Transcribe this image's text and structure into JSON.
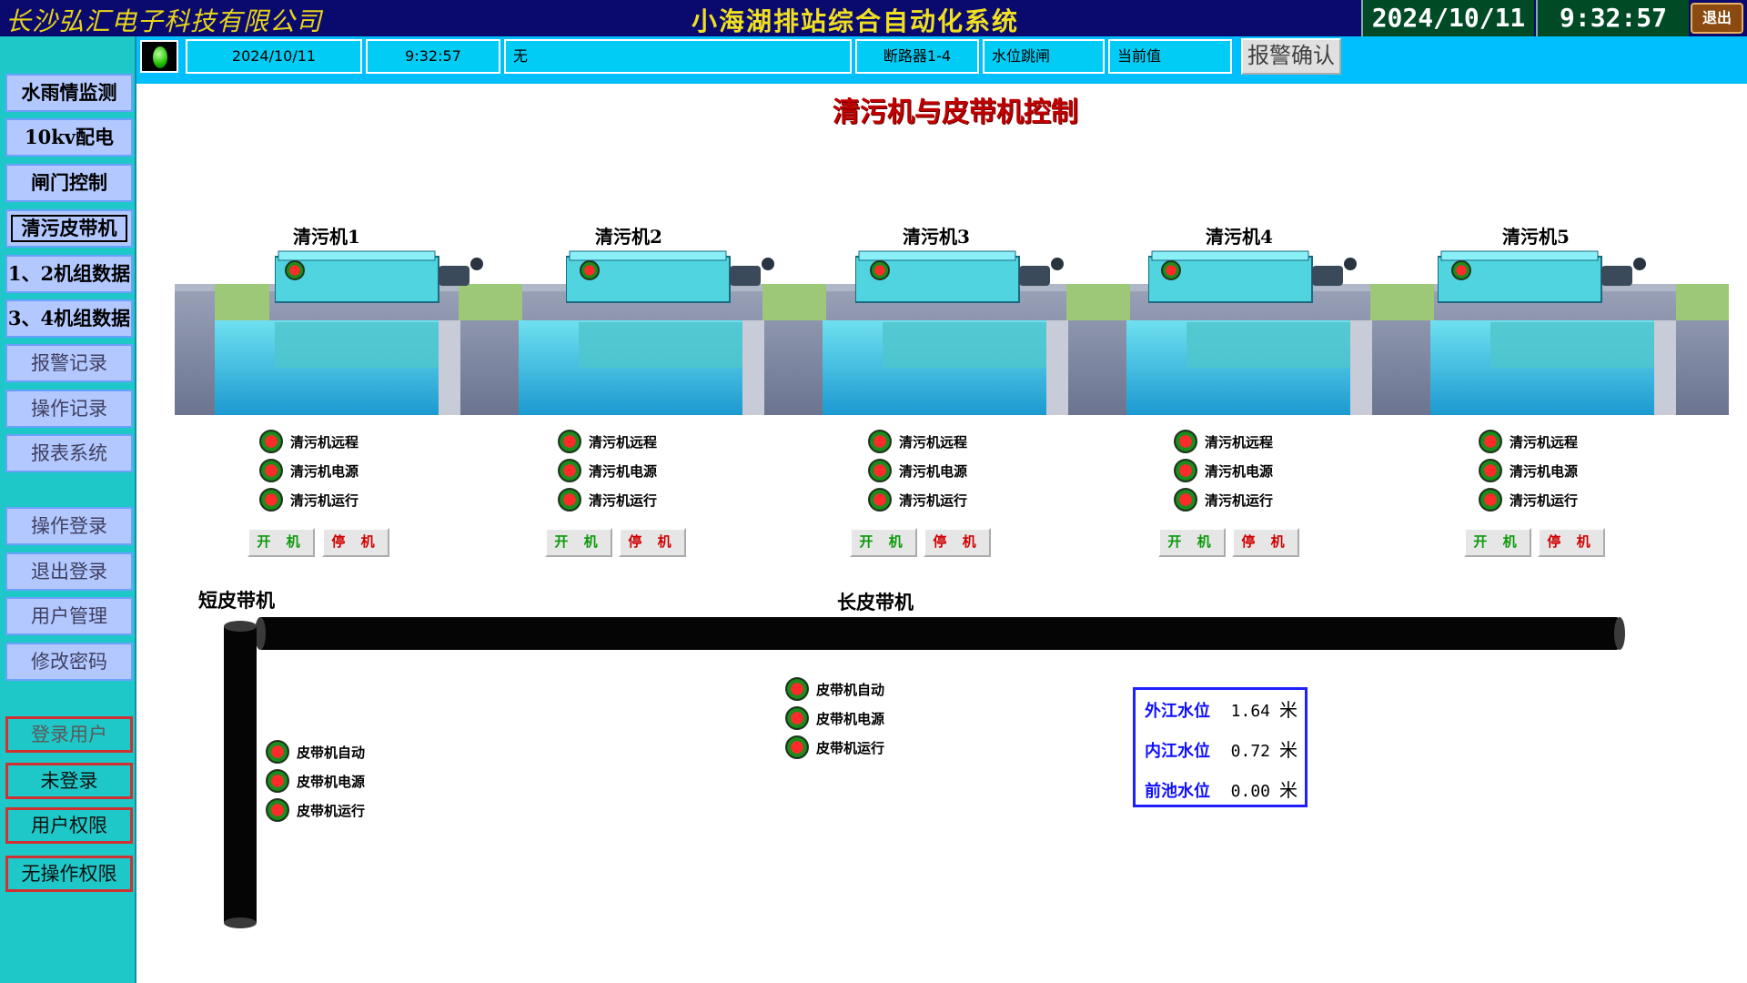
{
  "header": {
    "company": "长沙弘汇电子科技有限公司",
    "system_title": "小海湖排站综合自动化系统",
    "date": "2024/10/11",
    "time": "9:32:57",
    "exit_label": "退出"
  },
  "status_bar": {
    "indicator_color": "#1fbf00",
    "date": "2024/10/11",
    "time": "9:32:57",
    "message": "无",
    "device": "断路器1-4",
    "event": "水位跳闸",
    "value_label": "当前值",
    "ack_button": "报警确认"
  },
  "sidebar": {
    "nav": [
      {
        "label": "水雨情监测"
      },
      {
        "label": "10kv配电"
      },
      {
        "label": "闸门控制"
      },
      {
        "label": "清污皮带机"
      },
      {
        "label": "1、2机组数据"
      },
      {
        "label": "3、4机组数据"
      },
      {
        "label": "报警记录"
      },
      {
        "label": "操作记录"
      },
      {
        "label": "报表系统"
      },
      {
        "label": "操作登录"
      },
      {
        "label": "退出登录"
      },
      {
        "label": "用户管理"
      },
      {
        "label": "修改密码"
      }
    ],
    "login_user_label": "登录用户",
    "login_status": "未登录",
    "permission_label": "用户权限",
    "permission_status": "无操作权限"
  },
  "main": {
    "title": "清污机与皮带机控制",
    "cleaners": [
      {
        "name": "清污机1"
      },
      {
        "name": "清污机2"
      },
      {
        "name": "清污机3"
      },
      {
        "name": "清污机4"
      },
      {
        "name": "清污机5"
      }
    ],
    "cleaner_signals": [
      "清污机远程",
      "清污机电源",
      "清污机运行"
    ],
    "start_label": "开 机",
    "stop_label": "停 机",
    "short_belt_label": "短皮带机",
    "long_belt_label": "长皮带机",
    "belt_signals": [
      "皮带机自动",
      "皮带机电源",
      "皮带机运行"
    ],
    "water_levels": [
      {
        "name": "外江水位",
        "value": "1.64",
        "unit": "米"
      },
      {
        "name": "内江水位",
        "value": "0.72",
        "unit": "米"
      },
      {
        "name": "前池水位",
        "value": "0.00",
        "unit": "米"
      }
    ]
  }
}
